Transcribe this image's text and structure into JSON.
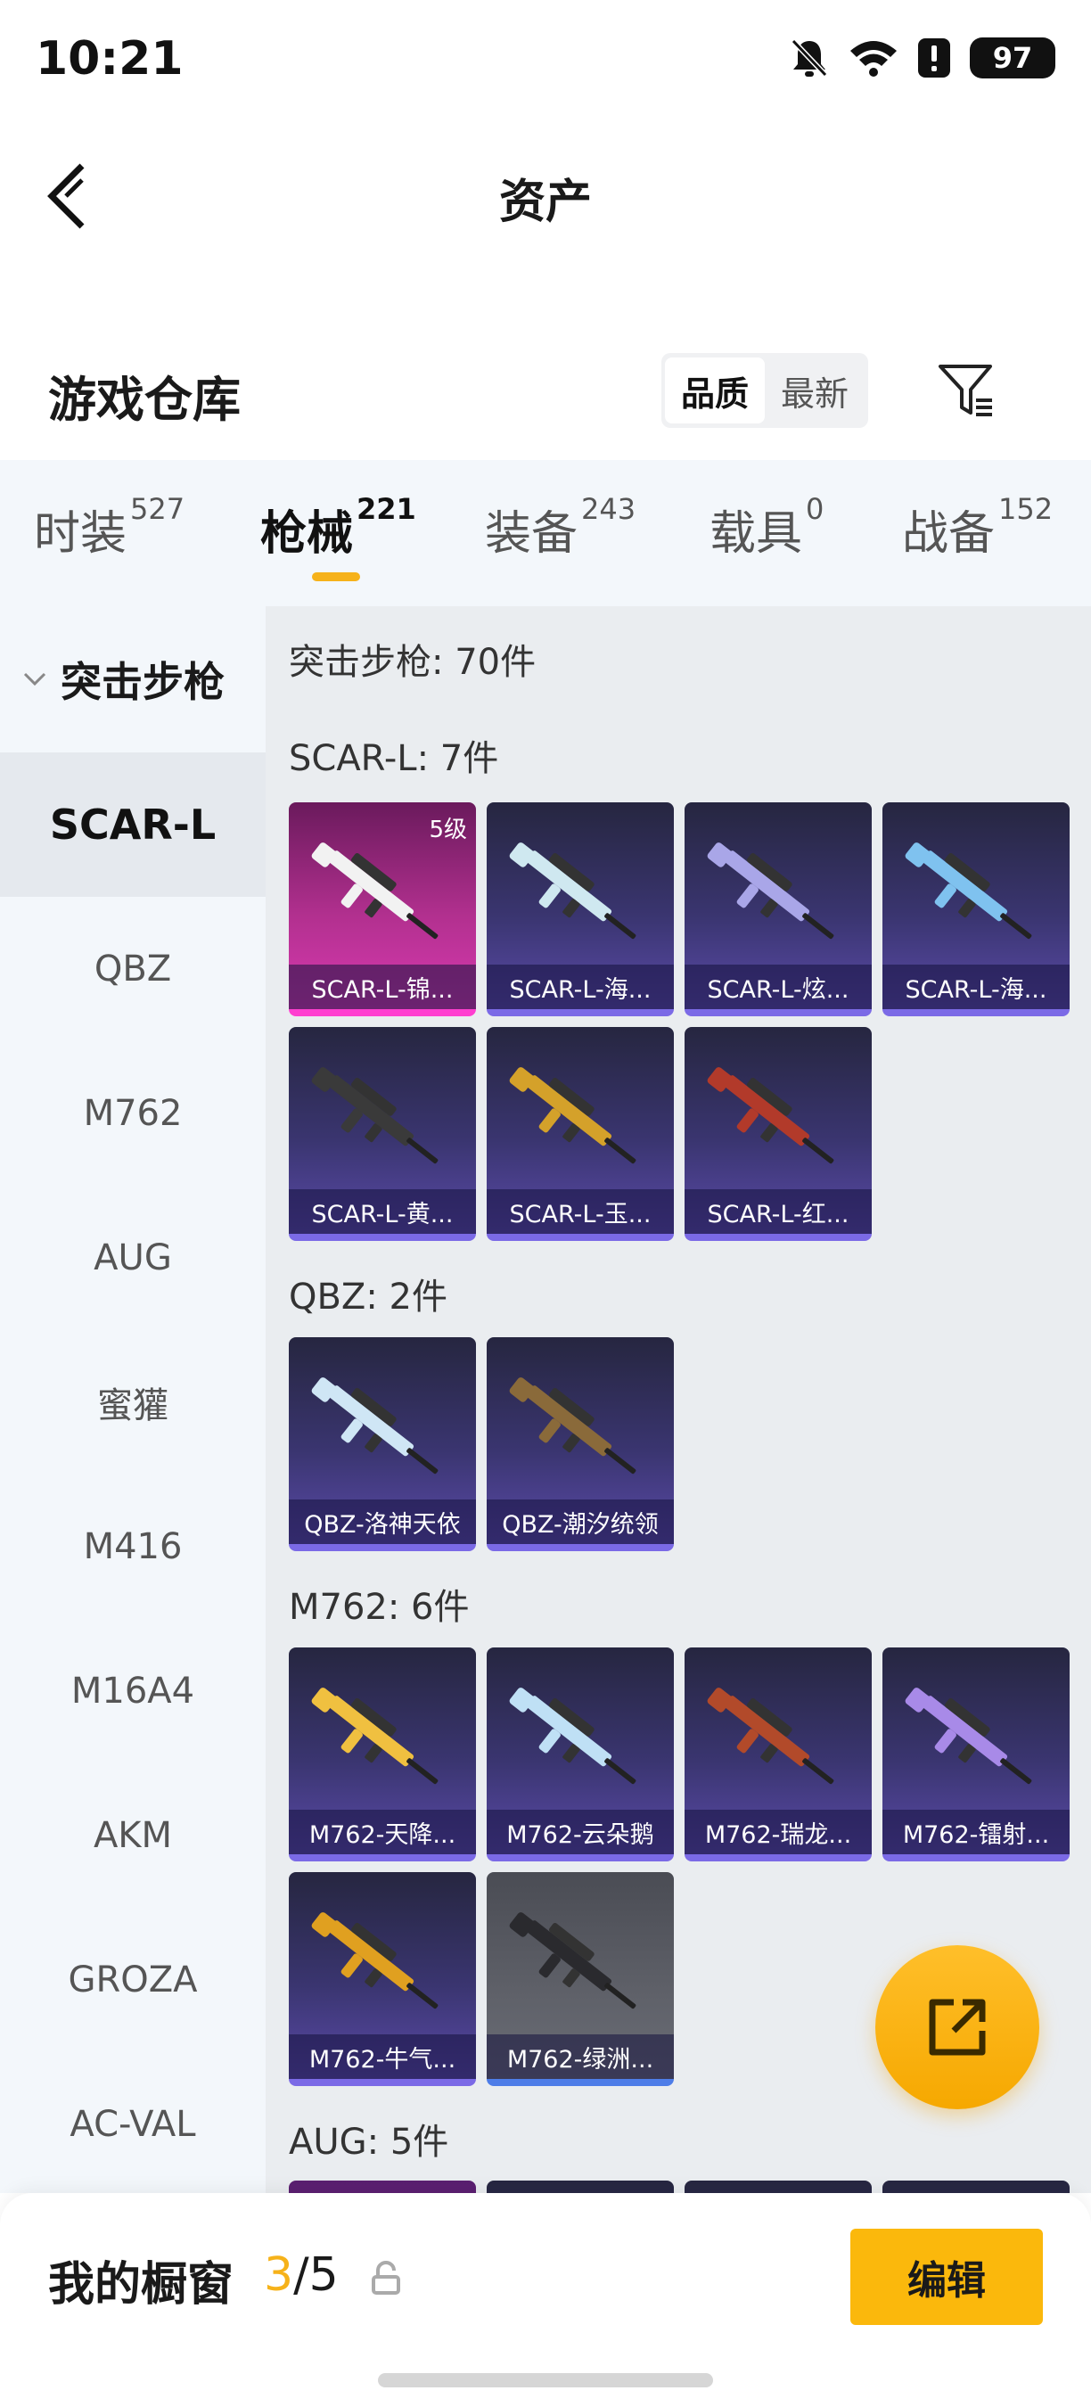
{
  "status_bar": {
    "time": "10:21",
    "battery": "97",
    "icons": [
      "mute-icon",
      "wifi-icon",
      "alert-icon",
      "battery-icon"
    ]
  },
  "header": {
    "title": "资产",
    "back_icon": "back-arrow-icon"
  },
  "section": {
    "title": "游戏仓库",
    "sort_options": [
      "品质",
      "最新"
    ],
    "sort_active": "品质",
    "filter_icon": "filter-icon"
  },
  "tabs": [
    {
      "label": "时装",
      "count": "527"
    },
    {
      "label": "枪械",
      "count": "221"
    },
    {
      "label": "装备",
      "count": "243"
    },
    {
      "label": "载具",
      "count": "0"
    },
    {
      "label": "战备",
      "count": "152"
    }
  ],
  "active_tab": "枪械",
  "sidebar": {
    "group_label": "突击步枪",
    "items": [
      "SCAR-L",
      "QBZ",
      "M762",
      "AUG",
      "蜜獾",
      "M416",
      "M16A4",
      "AKM",
      "GROZA",
      "AC-VAL"
    ],
    "active_item": "SCAR-L"
  },
  "content": {
    "category_title": "突击步枪: 70件",
    "groups": [
      {
        "title": "SCAR-L: 7件",
        "items": [
          {
            "label": "SCAR-L-锦...",
            "badge": "5级",
            "style": "pink"
          },
          {
            "label": "SCAR-L-海...",
            "style": "purple"
          },
          {
            "label": "SCAR-L-炫...",
            "style": "purple"
          },
          {
            "label": "SCAR-L-海...",
            "style": "purple"
          },
          {
            "label": "SCAR-L-黄...",
            "style": "purple"
          },
          {
            "label": "SCAR-L-玉...",
            "style": "purple"
          },
          {
            "label": "SCAR-L-红...",
            "style": "purple"
          }
        ]
      },
      {
        "title": "QBZ: 2件",
        "items": [
          {
            "label": "QBZ-洛神天依",
            "style": "purple"
          },
          {
            "label": "QBZ-潮汐统领",
            "style": "purple"
          }
        ]
      },
      {
        "title": "M762: 6件",
        "items": [
          {
            "label": "M762-天降...",
            "style": "purple"
          },
          {
            "label": "M762-云朵鹅",
            "style": "purple"
          },
          {
            "label": "M762-瑞龙...",
            "style": "purple"
          },
          {
            "label": "M762-镭射...",
            "style": "purple"
          },
          {
            "label": "M762-牛气...",
            "style": "purple"
          },
          {
            "label": "M762-绿洲...",
            "style": "gray"
          }
        ]
      },
      {
        "title": "AUG: 5件",
        "items": []
      }
    ]
  },
  "fab_icon": "share-external-icon",
  "bottom_bar": {
    "label": "我的橱窗",
    "count_current": "3",
    "count_total": "/5",
    "lock_icon": "lock-icon",
    "edit_button": "编辑"
  },
  "colors": {
    "accent": "#f6b21a",
    "edit_button": "#fbb80c",
    "card_purple": "#3a3570",
    "card_pink": "#b2308f",
    "card_gray": "#5f6169"
  }
}
